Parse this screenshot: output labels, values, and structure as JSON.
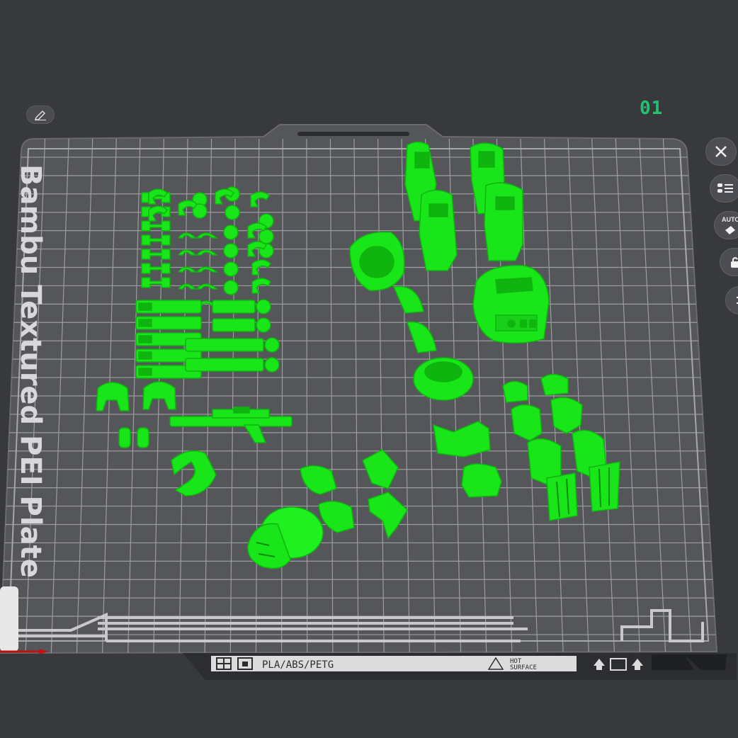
{
  "plate": {
    "index": "01",
    "texture_label": "Bambu Textured PEI Plate",
    "material_label": "PLA/ABS/PETG",
    "hot_surface_line1": "HOT",
    "hot_surface_line2": "SURFACE"
  },
  "toolbar": {
    "edit_icon": "pencil-icon",
    "buttons": [
      {
        "name": "close-plate",
        "icon": "close-icon"
      },
      {
        "name": "arrange-objects",
        "icon": "arrange-icon"
      },
      {
        "name": "auto-orient",
        "icon": "auto-orient-icon",
        "label": "AUTO"
      },
      {
        "name": "lock-plate",
        "icon": "lock-icon"
      },
      {
        "name": "plate-settings",
        "icon": "settings-icon"
      }
    ]
  },
  "colors": {
    "background": "#38393d",
    "plate": "#55565a",
    "grid": "#a9aaac",
    "model": "#19e619",
    "model_shade": "#0fb40f",
    "accent": "#22c36f"
  }
}
